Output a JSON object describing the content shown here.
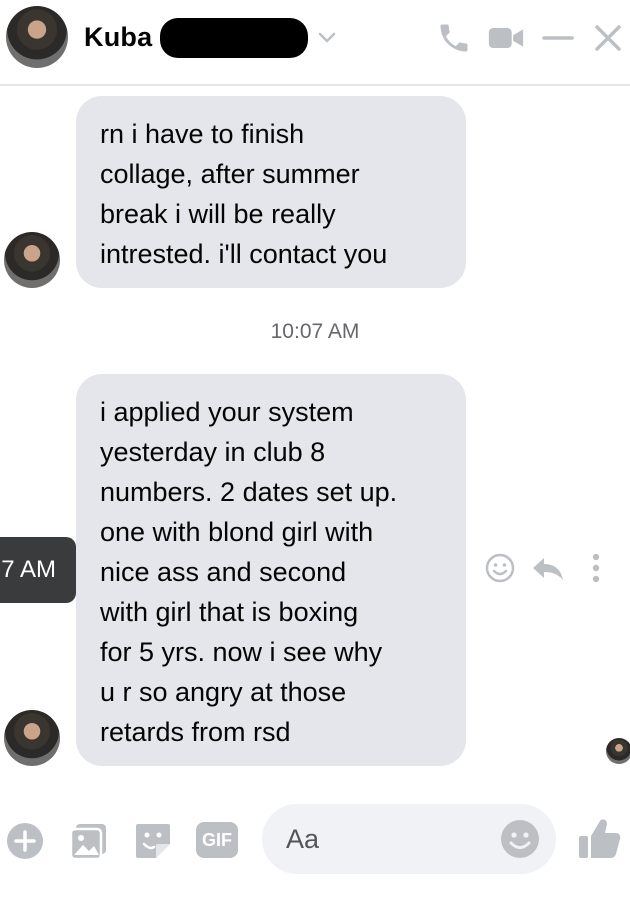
{
  "header": {
    "contact_name": "Kuba",
    "icons": [
      "avatar",
      "chevron-down-icon",
      "phone-icon",
      "video-icon",
      "minimize-icon",
      "close-icon"
    ]
  },
  "messages": [
    {
      "sender": "contact",
      "text": "rn i have to finish\ncollage, after summer\nbreak i will be really\nintrested. i'll contact you"
    },
    {
      "sender": "contact",
      "text": "i applied your system\nyesterday in club 8\nnumbers. 2 dates set up.\none with blond girl with\nnice ass and second\nwith girl that is boxing\nfor 5 yrs. now i see why\nu r so angry at those\nretards from rsd"
    }
  ],
  "timestamp": "10:07 AM",
  "hover_tooltip": "7 AM",
  "message_actions": [
    "react-icon",
    "reply-icon",
    "more-icon"
  ],
  "composer": {
    "placeholder": "Aa",
    "icons": [
      "plus-icon",
      "photo-icon",
      "sticker-icon",
      "gif-icon",
      "emoji-icon",
      "like-icon"
    ],
    "gif_label": "GIF"
  },
  "colors": {
    "bubble": "#e4e6eb",
    "icon_gray": "#bcc0c4",
    "tooltip_bg": "#3a3b3c",
    "timestamp": "#65676b"
  }
}
